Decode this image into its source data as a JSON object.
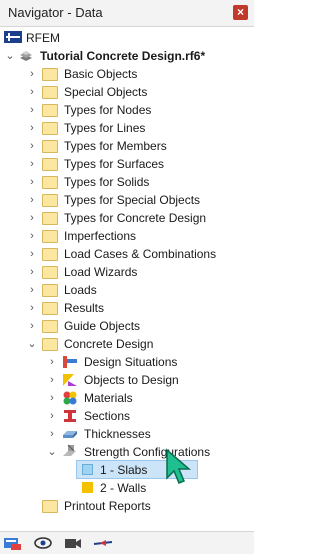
{
  "window": {
    "title": "Navigator - Data"
  },
  "tree": {
    "root_label": "RFEM",
    "file_label": "Tutorial Concrete Design.rf6*",
    "folders": [
      "Basic Objects",
      "Special Objects",
      "Types for Nodes",
      "Types for Lines",
      "Types for Members",
      "Types for Surfaces",
      "Types for Solids",
      "Types for Special Objects",
      "Types for Concrete Design",
      "Imperfections",
      "Load Cases & Combinations",
      "Load Wizards",
      "Loads",
      "Results",
      "Guide Objects"
    ],
    "concrete_design": {
      "label": "Concrete Design",
      "children": [
        {
          "label": "Design Situations",
          "icon": "design-situations-icon"
        },
        {
          "label": "Objects to Design",
          "icon": "objects-to-design-icon"
        },
        {
          "label": "Materials",
          "icon": "materials-icon"
        },
        {
          "label": "Sections",
          "icon": "sections-icon"
        },
        {
          "label": "Thicknesses",
          "icon": "thicknesses-icon"
        },
        {
          "label": "Strength Configurations",
          "icon": "strength-configurations-icon"
        }
      ],
      "strength_configurations": [
        {
          "label": "1 - Slabs",
          "color": "#9fd3f2",
          "selected": true
        },
        {
          "label": "2 - Walls",
          "color": "#f2c200",
          "selected": false
        }
      ]
    },
    "printout_label": "Printout Reports"
  },
  "colors": {
    "selection": "#cce4f7",
    "folder": "#fbe7a0",
    "cursor": "#1fbf8f"
  }
}
